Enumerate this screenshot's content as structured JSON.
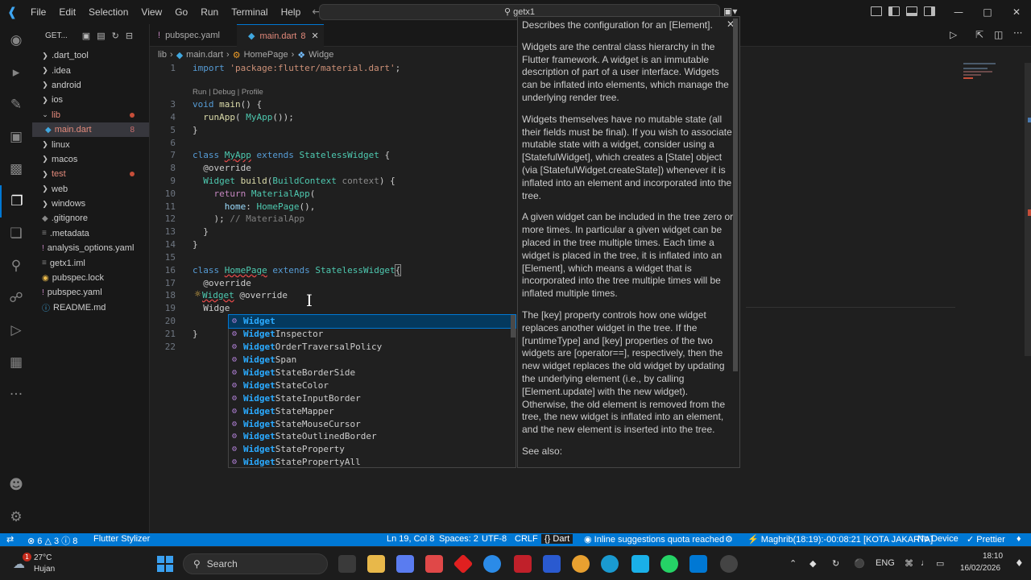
{
  "menu": [
    "File",
    "Edit",
    "Selection",
    "View",
    "Go",
    "Run",
    "Terminal",
    "Help"
  ],
  "command_center": "getx1",
  "sidebar": {
    "title": "GET...",
    "items": [
      {
        "label": ".dart_tool",
        "type": "folder",
        "open": false
      },
      {
        "label": ".idea",
        "type": "folder",
        "open": false
      },
      {
        "label": "android",
        "type": "folder",
        "open": false
      },
      {
        "label": "ios",
        "type": "folder",
        "open": false
      },
      {
        "label": "lib",
        "type": "folder",
        "open": true
      },
      {
        "label": "main.dart",
        "type": "file",
        "badge": "8"
      },
      {
        "label": "linux",
        "type": "folder",
        "open": false
      },
      {
        "label": "macos",
        "type": "folder",
        "open": false
      },
      {
        "label": "test",
        "type": "folder",
        "open": false
      },
      {
        "label": "web",
        "type": "folder",
        "open": false
      },
      {
        "label": "windows",
        "type": "folder",
        "open": false
      },
      {
        "label": ".gitignore",
        "type": "file"
      },
      {
        "label": ".metadata",
        "type": "file"
      },
      {
        "label": "analysis_options.yaml",
        "type": "file"
      },
      {
        "label": "getx1.iml",
        "type": "file"
      },
      {
        "label": "pubspec.lock",
        "type": "file"
      },
      {
        "label": "pubspec.yaml",
        "type": "file"
      },
      {
        "label": "README.md",
        "type": "file"
      }
    ]
  },
  "tabs": [
    {
      "label": "pubspec.yaml"
    },
    {
      "label": "main.dart",
      "badge": "8"
    }
  ],
  "breadcrumb": [
    "lib",
    "main.dart",
    "HomePage",
    "Widge"
  ],
  "codelens": "Run | Debug | Profile",
  "code": {
    "l1": [
      "import ",
      "'package:flutter/material.dart'",
      ";"
    ],
    "l3": [
      "void ",
      "main",
      "() {"
    ],
    "l4": [
      "  ",
      "runApp",
      "( ",
      "MyApp",
      "());"
    ],
    "l5": "}",
    "l7": [
      "class ",
      "MyApp",
      " extends ",
      "StatelessWidget",
      " {"
    ],
    "l8": "  @override",
    "l9": [
      "  ",
      "Widget",
      " ",
      "build",
      "(",
      "BuildContext",
      " ",
      "context",
      ") {"
    ],
    "l10": [
      "    ",
      "return",
      " ",
      "MaterialApp",
      "("
    ],
    "l11": [
      "      ",
      "home",
      ": ",
      "HomePage",
      "(),"
    ],
    "l12": [
      "    ",
      "); ",
      "// MaterialApp"
    ],
    "l13": "  }",
    "l14": "}",
    "l16": [
      "class ",
      "HomePage",
      " extends ",
      "StatelessWidget",
      "{"
    ],
    "l17": "  @override",
    "l18": [
      "Widget",
      " @override"
    ],
    "l19": "  Widge",
    "l21": "}"
  },
  "suggestions": [
    {
      "match": "Widget",
      "rest": ""
    },
    {
      "match": "Widget",
      "rest": "Inspector"
    },
    {
      "match": "Widget",
      "rest": "OrderTraversalPolicy"
    },
    {
      "match": "Widget",
      "rest": "Span"
    },
    {
      "match": "Widget",
      "rest": "StateBorderSide"
    },
    {
      "match": "Widget",
      "rest": "StateColor"
    },
    {
      "match": "Widget",
      "rest": "StateInputBorder"
    },
    {
      "match": "Widget",
      "rest": "StateMapper"
    },
    {
      "match": "Widget",
      "rest": "StateMouseCursor"
    },
    {
      "match": "Widget",
      "rest": "StateOutlinedBorder"
    },
    {
      "match": "Widget",
      "rest": "StateProperty"
    },
    {
      "match": "Widget",
      "rest": "StatePropertyAll"
    }
  ],
  "docs": {
    "p0": "Describes the configuration for an [Element].",
    "p1": "Widgets are the central class hierarchy in the Flutter framework. A widget is an immutable description of part of a user interface. Widgets can be inflated into elements, which manage the underlying render tree.",
    "p2": "Widgets themselves have no mutable state (all their fields must be final). If you wish to associate mutable state with a widget, consider using a [StatefulWidget], which creates a [State] object (via [StatefulWidget.createState]) whenever it is inflated into an element and incorporated into the tree.",
    "p3": "A given widget can be included in the tree zero or more times. In particular a given widget can be placed in the tree multiple times. Each time a widget is placed in the tree, it is inflated into an [Element], which means a widget that is incorporated into the tree multiple times will be inflated multiple times.",
    "p4": "The [key] property controls how one widget replaces another widget in the tree. If the [runtimeType] and [key] properties of the two widgets are [operator==], respectively, then the new widget replaces the old widget by updating the underlying element (i.e., by calling [Element.update] with the new widget). Otherwise, the old element is removed from the tree, the new widget is inflated into an element, and the new element is inserted into the tree.",
    "p5": "See also:"
  },
  "status": {
    "errors": "6",
    "warnings": "3",
    "info": "8",
    "stylizer": "Flutter Stylizer",
    "position": "Ln 19, Col 8",
    "spaces": "Spaces: 2",
    "encoding": "UTF-8",
    "eol": "CRLF",
    "language": "Dart",
    "quota": "Inline suggestions quota reached",
    "prayer": "Maghrib(18:19):-00:08:21 [KOTA JAKARTA]",
    "device": "No Device",
    "prettier": "Prettier"
  },
  "taskbar": {
    "temp": "27°C",
    "weather": "Hujan",
    "notif": "1",
    "search": "Search",
    "lang": "ENG",
    "time": "18:10",
    "date": "16/02/2026"
  },
  "colors": {
    "accent": "#0078d4",
    "statusbar": "#0078d4",
    "bg": "#1f1f1f"
  }
}
